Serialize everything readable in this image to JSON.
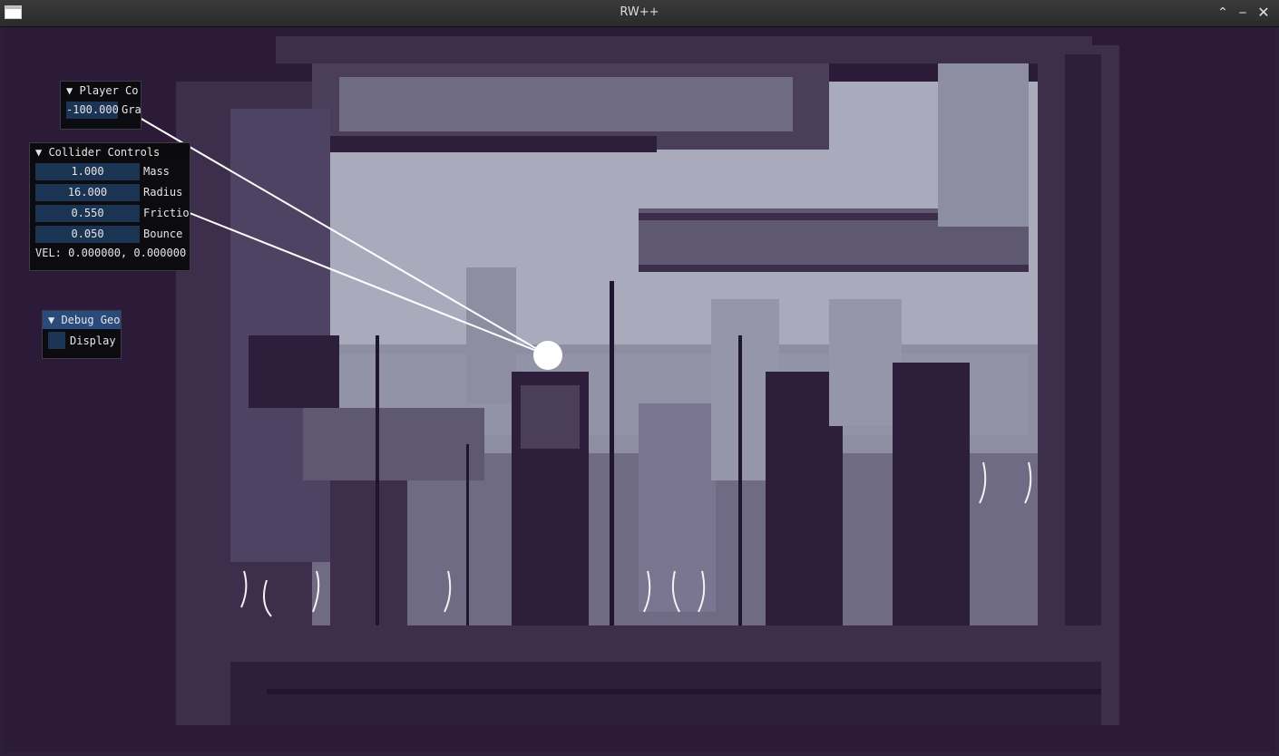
{
  "window": {
    "title": "RW++"
  },
  "player_controls": {
    "header": "▼ Player Co",
    "gravity_value": "-100.000",
    "gravity_label": "Gra"
  },
  "collider_controls": {
    "header": "▼ Collider Controls",
    "fields": [
      {
        "value": "1.000",
        "label": "Mass"
      },
      {
        "value": "16.000",
        "label": "Radius"
      },
      {
        "value": "0.550",
        "label": "Frictio"
      },
      {
        "value": "0.050",
        "label": "Bounce"
      }
    ],
    "velocity": "VEL: 0.000000, 0.000000"
  },
  "debug_geometry": {
    "header": "▼ Debug Geo",
    "display_label": "Display"
  },
  "colors": {
    "frame": "#2d1f3b",
    "sky": "#a9abbd",
    "field_bg": "#1b3453",
    "active_header": "#294a7a"
  }
}
